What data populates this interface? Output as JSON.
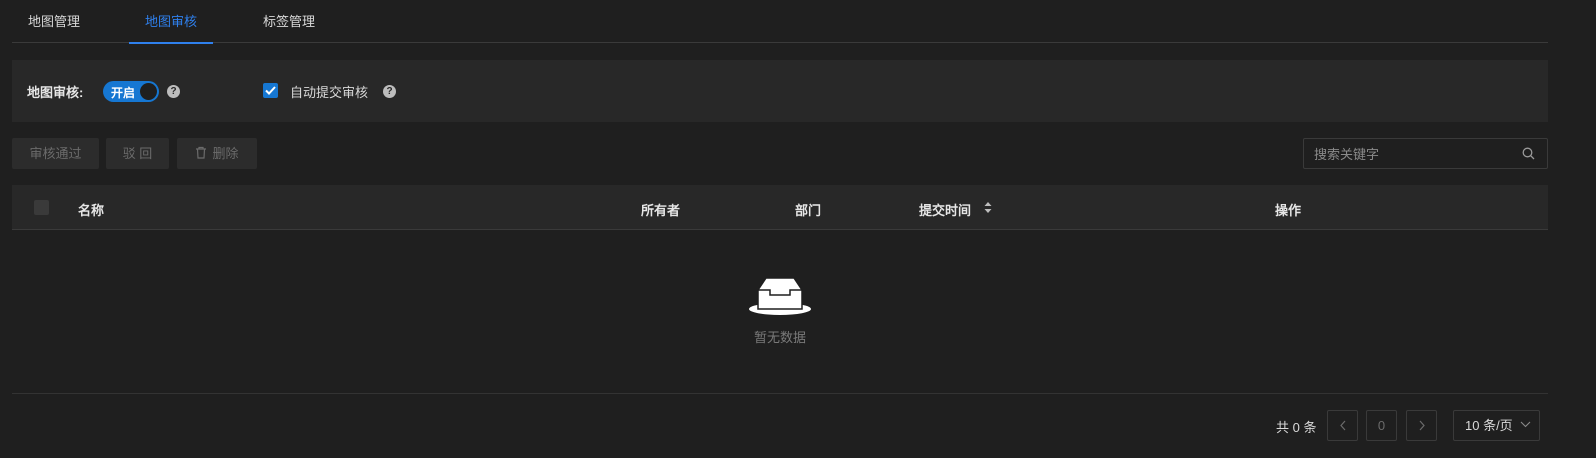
{
  "tabs": [
    {
      "label": "地图管理"
    },
    {
      "label": "地图审核",
      "active": true
    },
    {
      "label": "标签管理"
    }
  ],
  "settings": {
    "review_label": "地图审核:",
    "switch_text": "开启",
    "switch_on": true,
    "help_glyph": "?",
    "auto_submit_label": "自动提交审核",
    "auto_submit_checked": true
  },
  "toolbar": {
    "approve_label": "审核通过",
    "reject_label": "驳 回",
    "delete_label": "删除"
  },
  "search": {
    "placeholder": "搜索关键字"
  },
  "table": {
    "columns": [
      "名称",
      "所有者",
      "部门",
      "提交时间",
      "操作"
    ],
    "rows": [],
    "empty_text": "暂无数据"
  },
  "pagination": {
    "total_text": "共 0 条",
    "current_page": "0",
    "page_size": "10 条/页"
  },
  "colors": {
    "accent": "#2f80ed",
    "background": "#1f1f1f",
    "panel": "#282828"
  },
  "icons": [
    "help-icon",
    "check-icon",
    "trash-icon",
    "search-icon",
    "sort-icon",
    "empty-inbox-icon",
    "chevron-left-icon",
    "chevron-right-icon",
    "chevron-down-icon"
  ]
}
